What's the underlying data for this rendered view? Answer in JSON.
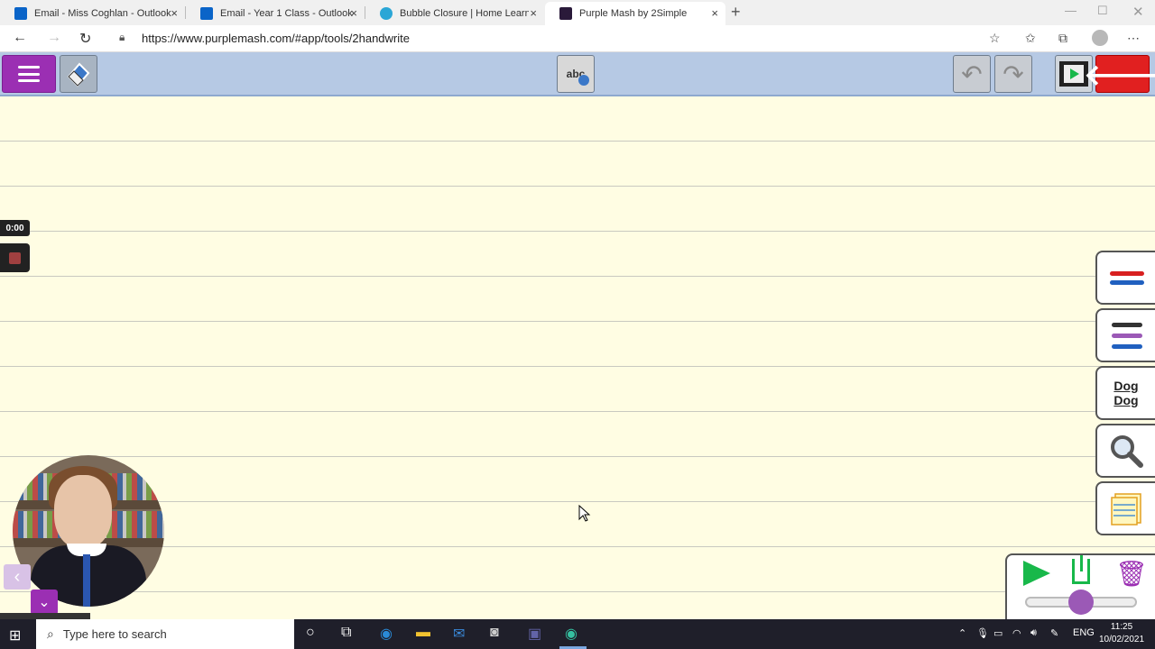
{
  "browser": {
    "tabs": [
      {
        "title": "Email - Miss Coghlan - Outlook",
        "icon": "outlook-icon",
        "color": "#0a64c8"
      },
      {
        "title": "Email - Year 1 Class - Outlook",
        "icon": "outlook-icon",
        "color": "#0a64c8"
      },
      {
        "title": "Bubble Closure | Home Learning",
        "icon": "globe-icon",
        "color": "#2aa6d6"
      },
      {
        "title": "Purple Mash by 2Simple",
        "icon": "purplemash-icon",
        "color": "#2a1a3a"
      }
    ],
    "url": "https://www.purplemash.com/#app/tools/2handwrite",
    "close_glyph": "×",
    "newtab_glyph": "+"
  },
  "app": {
    "toolbar": {
      "spell_label": "abc"
    },
    "recorder": {
      "time": "0:00"
    },
    "side_tools": [
      {
        "name": "pen-colour-tool"
      },
      {
        "name": "pen-style-tool"
      },
      {
        "name": "font-style-tool",
        "label_top": "Dog",
        "label_bottom": "Dog"
      },
      {
        "name": "zoom-tool"
      },
      {
        "name": "paper-style-tool"
      }
    ],
    "playback": {
      "speed_level": 0.5
    }
  },
  "taskbar": {
    "search_placeholder": "Type here to search",
    "language": "ENG",
    "time": "11:25",
    "date": "10/02/2021"
  }
}
